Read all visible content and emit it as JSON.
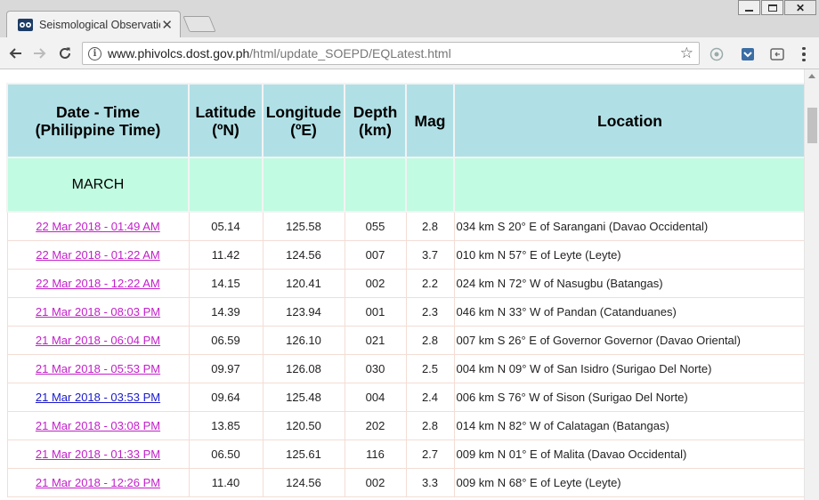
{
  "browser": {
    "tab_title": "Seismological Observatio",
    "url_domain": "www.phivolcs.dost.gov.ph",
    "url_path": "/html/update_SOEPD/EQLatest.html",
    "icons": [
      "back-arrow-icon",
      "forward-arrow-icon",
      "reload-icon",
      "info-icon",
      "bookmark-star-icon",
      "extension-icon",
      "menu-icon"
    ]
  },
  "table": {
    "headers": {
      "datetime_1": "Date - Time",
      "datetime_2": "(Philippine Time)",
      "lat_1": "Latitude",
      "lat_2": "(ºN)",
      "lon_1": "Longitude",
      "lon_2": "(ºE)",
      "depth_1": "Depth",
      "depth_2": "(km)",
      "mag": "Mag",
      "location": "Location"
    },
    "month": "MARCH",
    "rows": [
      {
        "datetime": "22 Mar 2018 - 01:49 AM",
        "lat": "05.14",
        "lon": "125.58",
        "depth": "055",
        "mag": "2.8",
        "location": "034 km S 20° E of Sarangani (Davao Occidental)"
      },
      {
        "datetime": "22 Mar 2018 - 01:22 AM",
        "lat": "11.42",
        "lon": "124.56",
        "depth": "007",
        "mag": "3.7",
        "location": "010 km N 57° E of Leyte (Leyte)"
      },
      {
        "datetime": "22 Mar 2018 - 12:22 AM",
        "lat": "14.15",
        "lon": "120.41",
        "depth": "002",
        "mag": "2.2",
        "location": "024 km N 72° W of Nasugbu (Batangas)"
      },
      {
        "datetime": "21 Mar 2018 - 08:03 PM",
        "lat": "14.39",
        "lon": "123.94",
        "depth": "001",
        "mag": "2.3",
        "location": "046 km N 33° W of Pandan (Catanduanes)"
      },
      {
        "datetime": "21 Mar 2018 - 06:04 PM",
        "lat": "06.59",
        "lon": "126.10",
        "depth": "021",
        "mag": "2.8",
        "location": "007 km S 26° E of Governor Governor (Davao Oriental)"
      },
      {
        "datetime": "21 Mar 2018 - 05:53 PM",
        "lat": "09.97",
        "lon": "126.08",
        "depth": "030",
        "mag": "2.5",
        "location": "004 km N 09° W of San Isidro (Surigao Del Norte)"
      },
      {
        "datetime": "21 Mar 2018 - 03:53 PM",
        "lat": "09.64",
        "lon": "125.48",
        "depth": "004",
        "mag": "2.4",
        "location": "006 km S 76° W of Sison (Surigao Del Norte)"
      },
      {
        "datetime": "21 Mar 2018 - 03:08 PM",
        "lat": "13.85",
        "lon": "120.50",
        "depth": "202",
        "mag": "2.8",
        "location": "014 km N 82° W of Calatagan (Batangas)"
      },
      {
        "datetime": "21 Mar 2018 - 01:33 PM",
        "lat": "06.50",
        "lon": "125.61",
        "depth": "116",
        "mag": "2.7",
        "location": "009 km N 01° E of Malita (Davao Occidental)"
      },
      {
        "datetime": "21 Mar 2018 - 12:26 PM",
        "lat": "11.40",
        "lon": "124.56",
        "depth": "002",
        "mag": "3.3",
        "location": "009 km N 68° E of Leyte (Leyte)"
      }
    ]
  },
  "colors": {
    "header_bg": "#b0e0e6",
    "month_bg": "#c1fbe2",
    "link": "#c21fc9",
    "link_visited": "#1a1acc",
    "row_border": "#f3ddd5"
  }
}
